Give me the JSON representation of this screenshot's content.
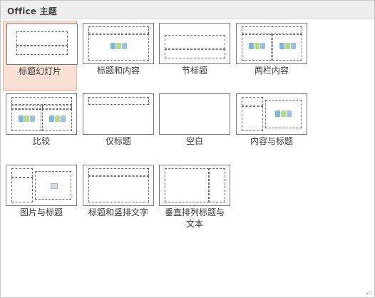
{
  "header": {
    "title": "Office 主题"
  },
  "layouts": [
    {
      "label": "标题幻灯片"
    },
    {
      "label": "标题和内容"
    },
    {
      "label": "节标题"
    },
    {
      "label": "两栏内容"
    },
    {
      "label": "比较"
    },
    {
      "label": "仅标题"
    },
    {
      "label": "空白"
    },
    {
      "label": "内容与标题"
    },
    {
      "label": "图片与标题"
    },
    {
      "label": "标题和竖排文字"
    },
    {
      "label": "垂直排列标题与文本"
    }
  ],
  "selected_layout": "标题幻灯片",
  "colors": {
    "selected_fill": "#fbe0d6",
    "selected_border": "#f2b29b",
    "header_bg": "#eeeeee"
  }
}
